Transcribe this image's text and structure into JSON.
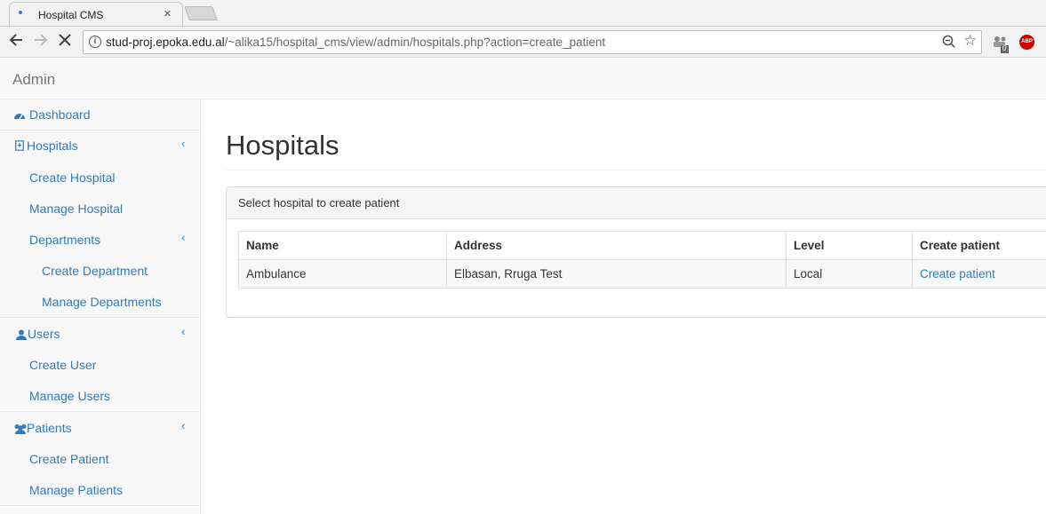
{
  "browser": {
    "tab_title": "Hospital CMS",
    "url_host": "stud-proj.epoka.edu.al",
    "url_path": "/~alika15/hospital_cms/view/admin/hospitals.php?action=create_patient",
    "extension_badge": "0",
    "abp_label": "ABP"
  },
  "navbar": {
    "brand": "Admin"
  },
  "sidebar": {
    "items": [
      {
        "label": "Dashboard",
        "icon": "dashboard-icon"
      },
      {
        "label": "Hospitals",
        "icon": "hospital-icon",
        "children": [
          "Create Hospital",
          "Manage Hospital"
        ],
        "departments": {
          "label": "Departments",
          "children": [
            "Create Department",
            "Manage Departments"
          ]
        }
      },
      {
        "label": "Users",
        "icon": "user-icon",
        "children": [
          "Create User",
          "Manage Users"
        ]
      },
      {
        "label": "Patients",
        "icon": "users-icon",
        "children": [
          "Create Patient",
          "Manage Patients"
        ]
      }
    ]
  },
  "main": {
    "title": "Hospitals",
    "panel_heading": "Select hospital to create patient",
    "table": {
      "headers": [
        "Name",
        "Address",
        "Level",
        "Create patient"
      ],
      "rows": [
        {
          "name": "Ambulance",
          "address": "Elbasan, Rruga Test",
          "level": "Local",
          "action": "Create patient"
        }
      ]
    }
  },
  "colors": {
    "link": "#337ab7",
    "sidebar_bg": "#f8f8f8",
    "border": "#e7e7e7"
  }
}
